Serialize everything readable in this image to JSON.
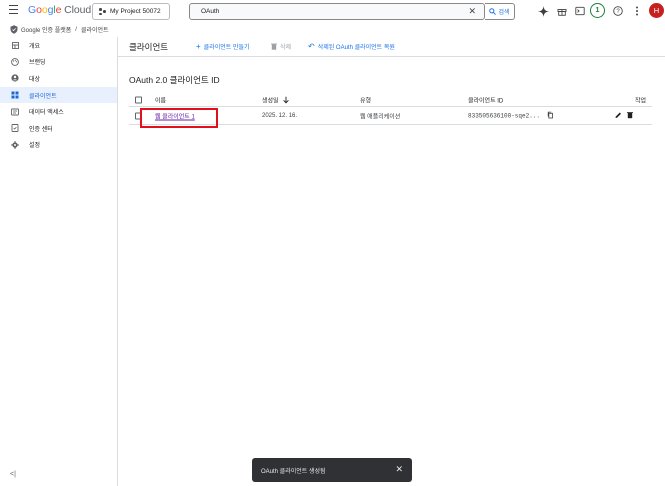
{
  "topbar": {
    "logo_google": [
      "G",
      "o",
      "o",
      "g",
      "l",
      "e"
    ],
    "logo_cloud": "Cloud",
    "project": "My Project 50072",
    "search_value": "OAuth",
    "search_button": "검색",
    "notification_count": "1",
    "avatar_letter": "H"
  },
  "breadcrumb": {
    "section": "Google 인증 플랫폼",
    "separator": "/",
    "current": "클라이언트"
  },
  "sidebar": {
    "items": [
      {
        "label": "개요",
        "icon": "dashboard-icon"
      },
      {
        "label": "브랜딩",
        "icon": "palette-icon"
      },
      {
        "label": "대상",
        "icon": "account-circle-icon"
      },
      {
        "label": "클라이언트",
        "icon": "key-grid-icon",
        "active": true
      },
      {
        "label": "데이터 액세스",
        "icon": "data-access-icon"
      },
      {
        "label": "인증 센터",
        "icon": "verification-icon"
      },
      {
        "label": "설정",
        "icon": "gear-icon"
      }
    ],
    "collapse_label": "<|"
  },
  "main": {
    "title": "클라이언트",
    "actions": {
      "create": "클라이언트 만들기",
      "delete": "삭제",
      "restore": "삭제된 OAuth 클라이언트 복원"
    },
    "section_title": "OAuth 2.0 클라이언트 ID",
    "table": {
      "headers": {
        "name": "이름",
        "created": "생성일",
        "type": "유형",
        "client_id": "클라이언트 ID",
        "actions": "작업"
      },
      "rows": [
        {
          "name": "웹 클라이언트 1",
          "created": "2025. 12. 16.",
          "type": "웹 애플리케이션",
          "client_id": "833505636100-sqe2..."
        }
      ]
    }
  },
  "snackbar": {
    "message": "OAuth 클라이언트 생성됨",
    "close": "✕"
  },
  "colors": {
    "accent": "#1a73e8",
    "active_bg": "#e8f0fe",
    "highlight": "#e1111b",
    "snackbar_bg": "#303134"
  }
}
